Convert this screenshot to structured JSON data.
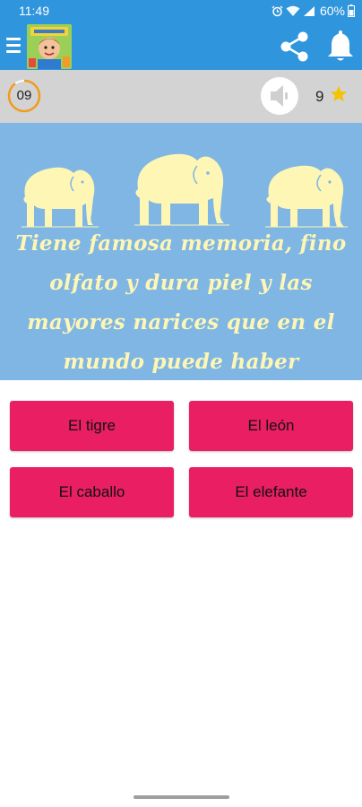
{
  "status_bar": {
    "time": "11:49",
    "battery": "60%",
    "icons": [
      "alarm-icon",
      "wifi-icon",
      "signal-icon",
      "battery-icon"
    ]
  },
  "app_bar": {
    "menu_icon": "menu-icon",
    "share_icon": "share-icon",
    "notifications_icon": "bell-icon",
    "color": "#2f95dc"
  },
  "score_bar": {
    "timer": "09",
    "timer_fraction_remaining": 0.9,
    "stars": "9",
    "sound_icon": "speaker-icon",
    "star_color": "#f5c400"
  },
  "question": {
    "text": "Tiene famosa memoria, fino olfato y dura piel y las mayores narices que en el mundo puede haber",
    "text_color": "#fdf6b5",
    "background": "#80b6e3"
  },
  "answers": [
    {
      "label": "El tigre"
    },
    {
      "label": "El león"
    },
    {
      "label": "El caballo"
    },
    {
      "label": "El elefante"
    }
  ],
  "accent_color": "#e91e63"
}
